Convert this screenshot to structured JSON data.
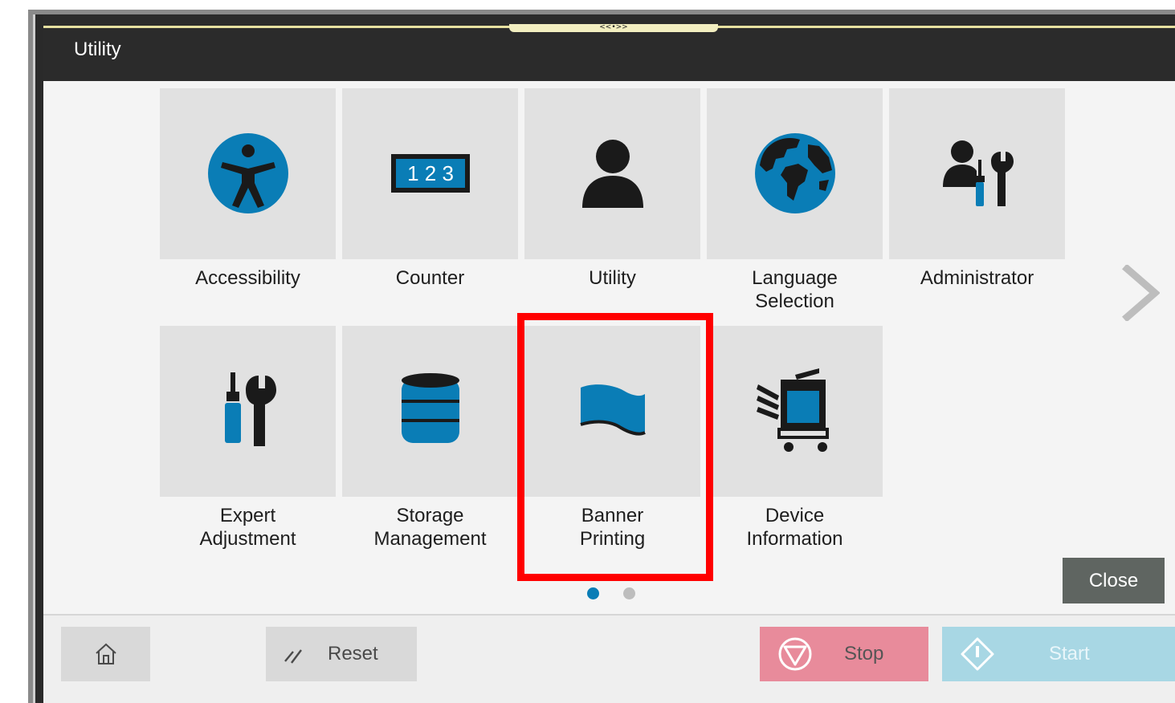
{
  "header": {
    "title": "Utility",
    "grip_glyph": "<<•>>"
  },
  "tiles": [
    {
      "label": "Accessibility",
      "icon": "accessibility-icon"
    },
    {
      "label": "Counter",
      "icon": "counter-icon",
      "counter_text": "1 2 3"
    },
    {
      "label": "Utility",
      "icon": "user-icon"
    },
    {
      "label": "Language\nSelection",
      "icon": "globe-icon"
    },
    {
      "label": "Administrator",
      "icon": "administrator-icon"
    },
    {
      "label": "Expert\nAdjustment",
      "icon": "tools-icon"
    },
    {
      "label": "Storage\nManagement",
      "icon": "database-icon"
    },
    {
      "label": "Banner\nPrinting",
      "icon": "banner-icon",
      "highlighted": true
    },
    {
      "label": "Device\nInformation",
      "icon": "device-icon"
    }
  ],
  "pagination": {
    "current_page": 1,
    "total_pages": 2
  },
  "close_button": {
    "label": "Close"
  },
  "bottom_bar": {
    "home_icon": "home-icon",
    "reset_label": "Reset",
    "stop_label": "Stop",
    "start_label": "Start"
  },
  "colors": {
    "accent_blue": "#0a7db6",
    "header_bg": "#2b2b2b",
    "tile_bg": "#e1e1e1",
    "highlight": "#ff0000",
    "stop_bg": "#e88b9b",
    "start_bg": "#a8d7e4",
    "close_bg": "#5f6561"
  }
}
